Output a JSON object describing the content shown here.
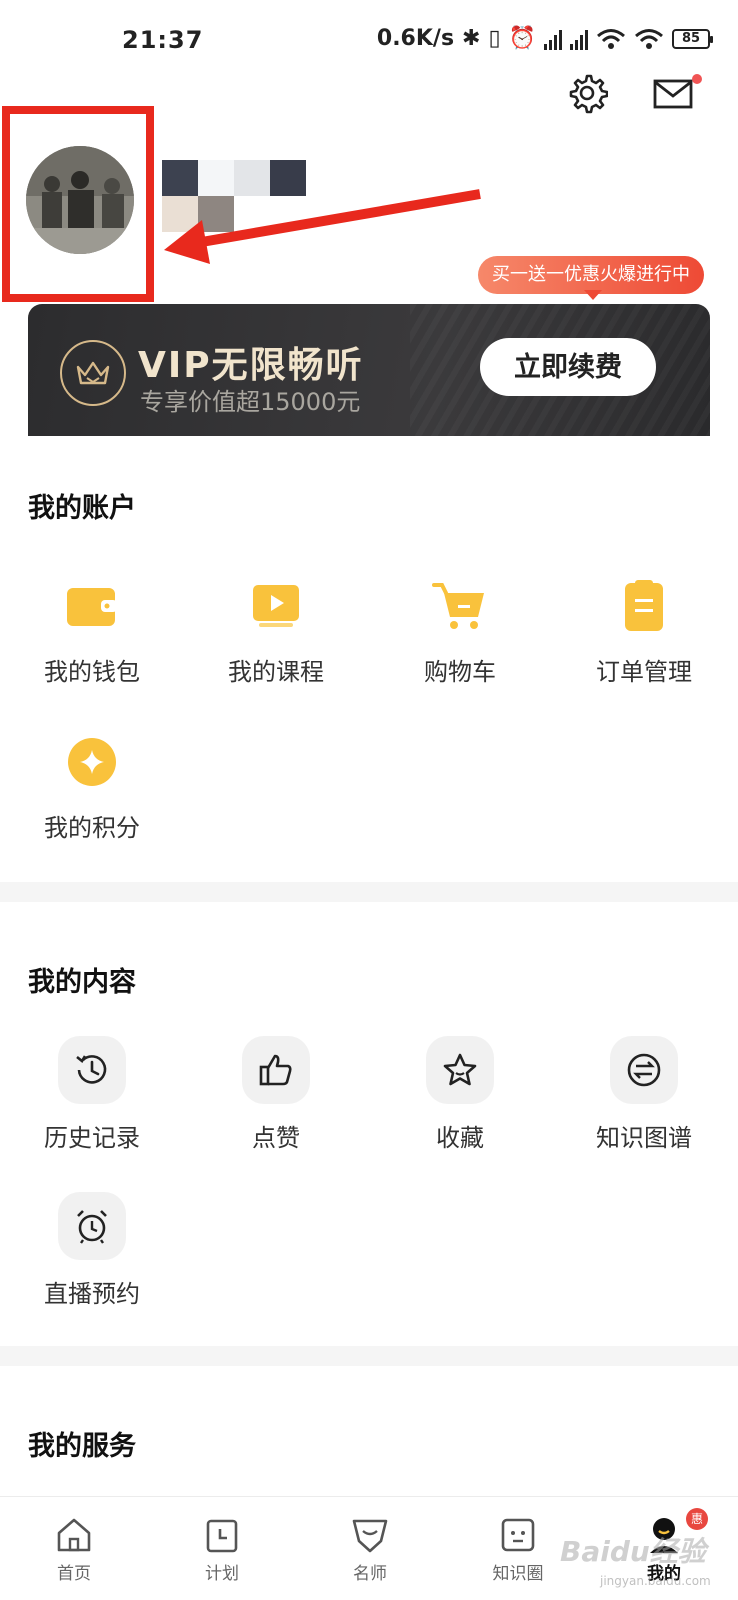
{
  "status": {
    "time": "21:37",
    "net_speed": "0.6K/s",
    "battery": "85"
  },
  "vip": {
    "promo": "买一送一优惠火爆进行中",
    "title": "VIP无限畅听",
    "subtitle": "专享价值超15000元",
    "button": "立即续费"
  },
  "account": {
    "title": "我的账户",
    "items": [
      {
        "label": "我的钱包",
        "icon": "wallet-icon"
      },
      {
        "label": "我的课程",
        "icon": "course-icon"
      },
      {
        "label": "购物车",
        "icon": "cart-icon"
      },
      {
        "label": "订单管理",
        "icon": "order-icon"
      },
      {
        "label": "我的积分",
        "icon": "points-icon"
      }
    ]
  },
  "content": {
    "title": "我的内容",
    "items": [
      {
        "label": "历史记录",
        "icon": "history-icon"
      },
      {
        "label": "点赞",
        "icon": "thumbs-up-icon"
      },
      {
        "label": "收藏",
        "icon": "star-icon"
      },
      {
        "label": "知识图谱",
        "icon": "exchange-icon"
      },
      {
        "label": "直播预约",
        "icon": "alarm-clock-icon"
      }
    ]
  },
  "services": {
    "title": "我的服务"
  },
  "nav": {
    "items": [
      {
        "label": "首页",
        "icon": "home-icon"
      },
      {
        "label": "计划",
        "icon": "calendar-icon"
      },
      {
        "label": "名师",
        "icon": "teacher-icon"
      },
      {
        "label": "知识圈",
        "icon": "circle-icon"
      },
      {
        "label": "我的",
        "icon": "profile-icon"
      }
    ],
    "badge": "惠"
  },
  "watermark": {
    "logo": "Baidu经验",
    "url": "jingyan.baidu.com"
  },
  "colors": {
    "accent_yellow": "#f9c23c",
    "annotation_red": "#e8291d",
    "promo_red": "#ee4a35"
  }
}
